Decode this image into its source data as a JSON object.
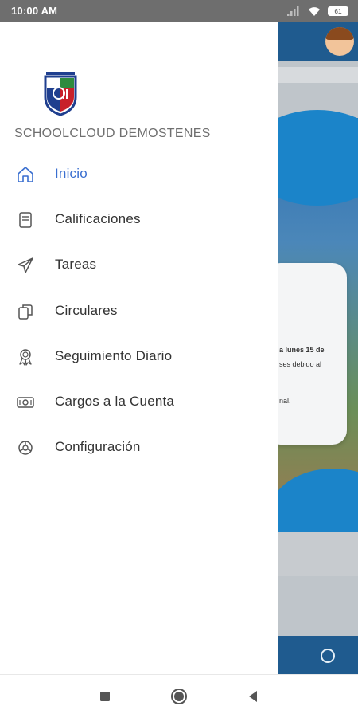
{
  "status_bar": {
    "time": "10:00 AM",
    "battery": "61"
  },
  "drawer": {
    "school_name": "SCHOOLCLOUD DEMOSTENES",
    "menu": [
      {
        "label": "Inicio",
        "icon": "home-icon",
        "active": true
      },
      {
        "label": "Calificaciones",
        "icon": "document-icon",
        "active": false
      },
      {
        "label": "Tareas",
        "icon": "send-icon",
        "active": false
      },
      {
        "label": "Circulares",
        "icon": "files-icon",
        "active": false
      },
      {
        "label": "Seguimiento Diario",
        "icon": "award-icon",
        "active": false
      },
      {
        "label": "Cargos a la Cuenta",
        "icon": "money-icon",
        "active": false
      },
      {
        "label": "Configuración",
        "icon": "gear-icon",
        "active": false
      }
    ]
  },
  "background": {
    "card_line1": "a lunes 15 de",
    "card_line2": "ses debido al",
    "card_line3": "nal."
  },
  "colors": {
    "accent": "#3a6fd0",
    "app_bar": "#1f5b8f",
    "status_bar": "#6e6e6e"
  }
}
